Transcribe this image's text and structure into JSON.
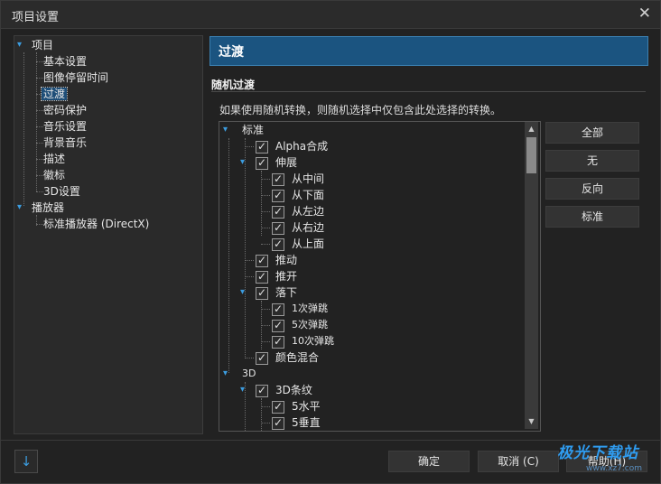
{
  "window": {
    "title": "项目设置",
    "close_icon": "✕"
  },
  "tree": {
    "root1": "项目",
    "children1": [
      "基本设置",
      "图像停留时间",
      "过渡",
      "密码保护",
      "音乐设置",
      "背景音乐",
      "描述",
      "徽标",
      "3D设置"
    ],
    "root2": "播放器",
    "children2": [
      "标准播放器 (DirectX)"
    ],
    "selected": "过渡"
  },
  "panel": {
    "header": "过渡",
    "section_title": "随机过渡",
    "description": "如果使用随机转换，则随机选择中仅包含此处选择的转换。"
  },
  "transitions": {
    "group1": "标准",
    "g1_items": {
      "alpha": "Alpha合成",
      "stretch": "伸展",
      "stretch_children": [
        "从中间",
        "从下面",
        "从左边",
        "从右边",
        "从上面"
      ],
      "push": "推动",
      "push_open": "推开",
      "drop": "落下",
      "drop_children": [
        "1次弹跳",
        "5次弹跳",
        "10次弹跳"
      ],
      "color_blend": "颜色混合"
    },
    "group2": "3D",
    "g2_items": {
      "stripes": "3D条纹",
      "stripes_children": [
        "5水平",
        "5垂直"
      ]
    }
  },
  "side_buttons": {
    "all": "全部",
    "none": "无",
    "invert": "反向",
    "standard": "标准"
  },
  "bottom_buttons": {
    "ok": "确定",
    "cancel": "取消 (C)",
    "help": "帮助(H)"
  },
  "watermark": {
    "text": "极光下载站",
    "url": "www.xz7.com"
  }
}
